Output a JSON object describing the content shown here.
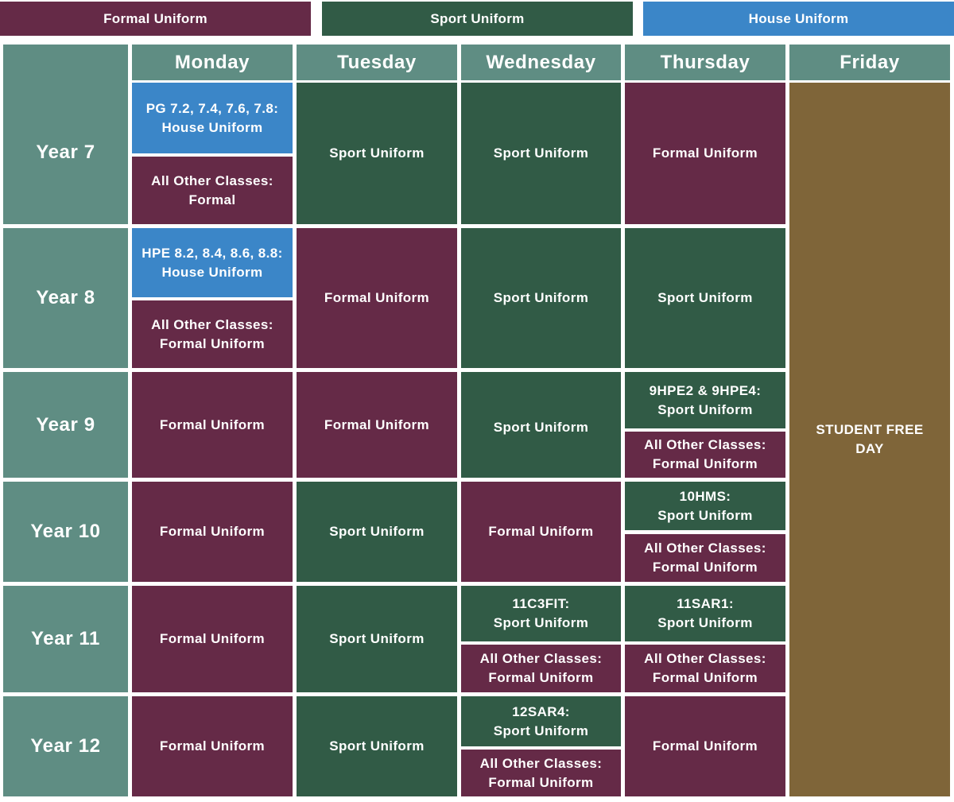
{
  "colors": {
    "formal": "#652a47",
    "sport": "#315b46",
    "house": "#3b86c8",
    "header": "#5f8d83",
    "free_day": "#7f6539"
  },
  "legend": {
    "formal": "Formal Uniform",
    "sport": "Sport Uniform",
    "house": "House Uniform"
  },
  "days": [
    "Monday",
    "Tuesday",
    "Wednesday",
    "Thursday",
    "Friday"
  ],
  "years": [
    "Year 7",
    "Year 8",
    "Year 9",
    "Year 10",
    "Year 11",
    "Year 12"
  ],
  "friday": "STUDENT FREE\nDAY",
  "cells": {
    "y7": {
      "mon_a": "PG 7.2, 7.4, 7.6, 7.8:\nHouse  Uniform",
      "mon_b": "All Other Classes:\nFormal",
      "tue": "Sport Uniform",
      "wed": "Sport Uniform",
      "thu": "Formal Uniform"
    },
    "y8": {
      "mon_a": "HPE 8.2, 8.4, 8.6, 8.8:\nHouse  Uniform",
      "mon_b": "All Other Classes:\nFormal  Uniform",
      "tue": "Formal Uniform",
      "wed": "Sport Uniform",
      "thu": "Sport Uniform"
    },
    "y9": {
      "mon": "Formal Uniform",
      "tue": "Formal Uniform",
      "wed": "Sport Uniform",
      "thu_a": "9HPE2 & 9HPE4:\nSport Uniform",
      "thu_b": "All Other Classes:\nFormal  Uniform"
    },
    "y10": {
      "mon": "Formal Uniform",
      "tue": "Sport Uniform",
      "wed": "Formal Uniform",
      "thu_a": "10HMS:\nSport Uniform",
      "thu_b": "All Other Classes:\nFormal Uniform"
    },
    "y11": {
      "mon": "Formal Uniform",
      "tue": "Sport Uniform",
      "wed_a": "11C3FIT:\nSport Uniform",
      "wed_b": "All Other Classes:\nFormal Uniform",
      "thu_a": "11SAR1:\nSport Uniform",
      "thu_b": "All Other Classes:\nFormal Uniform"
    },
    "y12": {
      "mon": "Formal Uniform",
      "tue": "Sport Uniform",
      "wed_a": "12SAR4:\nSport Uniform",
      "wed_b": "All Other Classes:\nFormal Uniform",
      "thu": "Formal Uniform"
    }
  }
}
